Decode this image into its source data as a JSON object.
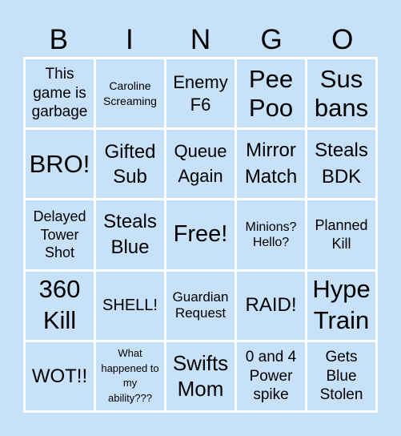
{
  "card": {
    "header": [
      "B",
      "I",
      "N",
      "G",
      "O"
    ],
    "cells": [
      [
        "This game is garbage",
        "Caroline Screaming",
        "Enemy F6",
        "Pee Poo",
        "Sus bans"
      ],
      [
        "BRO!",
        "Gifted Sub",
        "Queue Again",
        "Mirror Match",
        "Steals BDK"
      ],
      [
        "Delayed Tower Shot",
        "Steals Blue",
        "Free!",
        "Minions? Hello?",
        "Planned Kill"
      ],
      [
        "360 Kill",
        "SHELL!",
        "Guardian Request",
        "RAID!",
        "Hype Train"
      ],
      [
        "WOT!!",
        "What happened to my ability???",
        "Swifts Mom",
        "0 and 4 Power spike",
        "Gets Blue Stolen"
      ]
    ],
    "free_space": "Free!",
    "colors": {
      "background": "#c7e1f8",
      "cell": "#c7e1f8",
      "grid_lines": "#ffffff",
      "text": "#000000"
    }
  }
}
